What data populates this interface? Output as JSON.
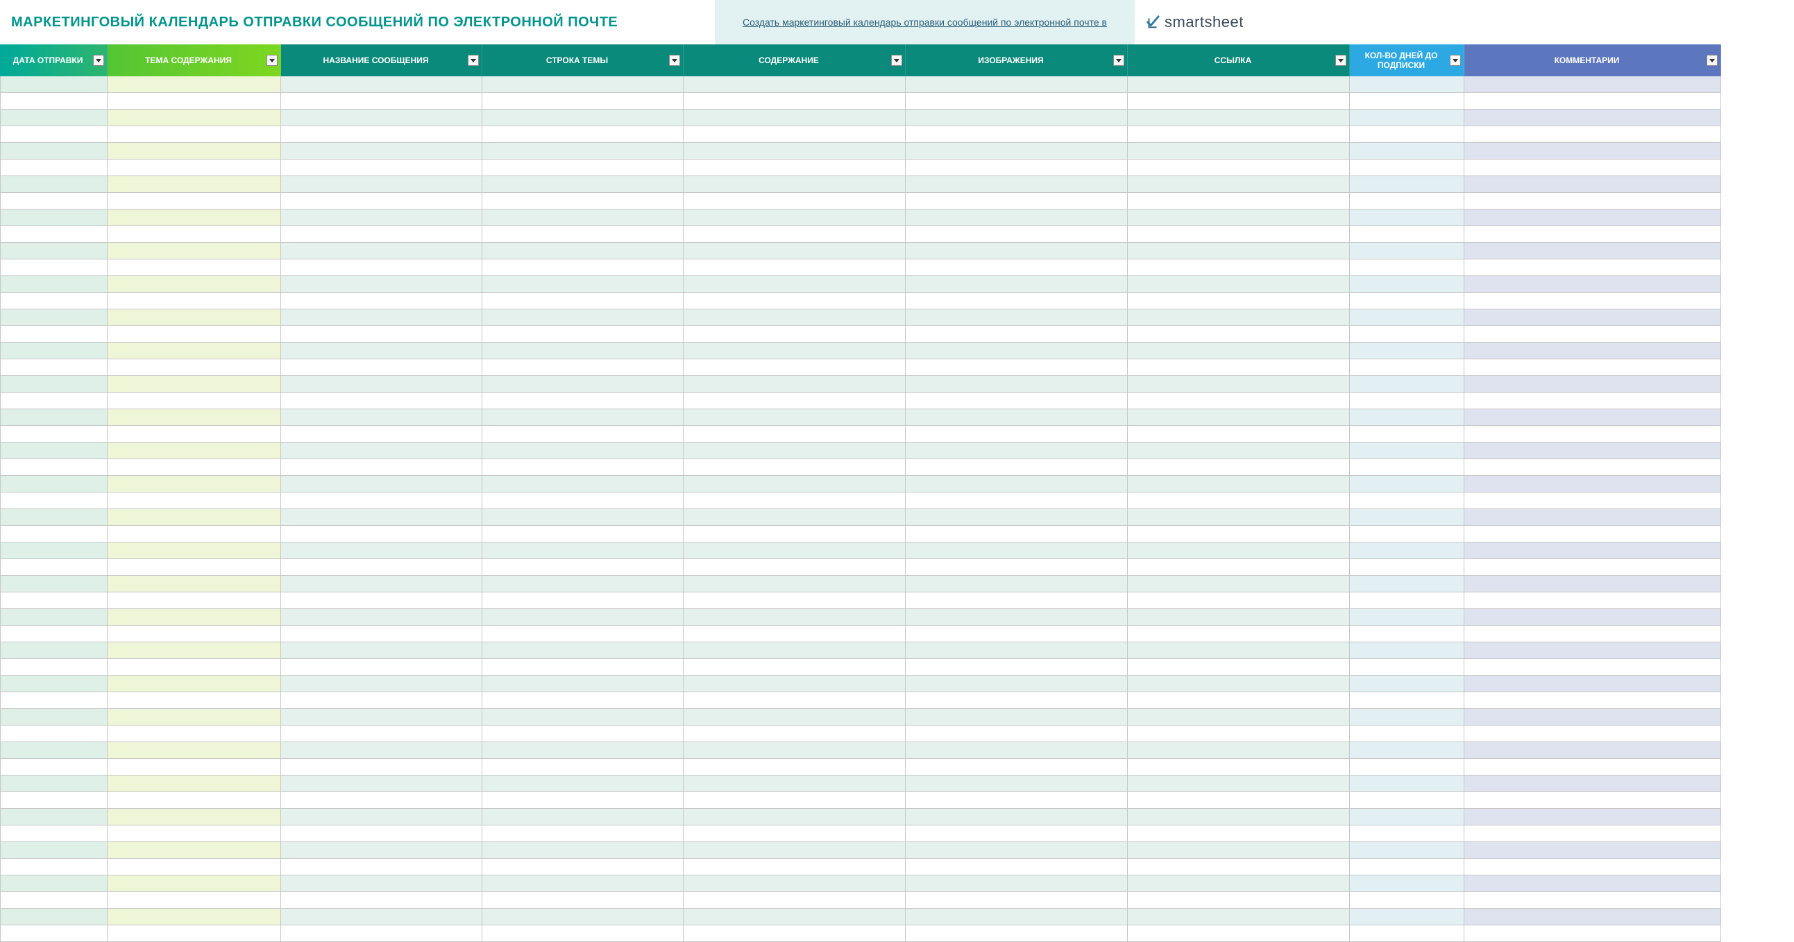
{
  "header": {
    "title": "МАРКЕТИНГОВЫЙ КАЛЕНДАРЬ ОТПРАВКИ СООБЩЕНИЙ ПО ЭЛЕКТРОННОЙ ПОЧТЕ",
    "link_text": "Создать маркетинговый календарь отправки сообщений по электронной почте в",
    "brand": "smartsheet"
  },
  "columns": [
    {
      "label": "ДАТА ОТПРАВКИ"
    },
    {
      "label": "ТЕМА СОДЕРЖАНИЯ"
    },
    {
      "label": "НАЗВАНИЕ СООБЩЕНИЯ"
    },
    {
      "label": "СТРОКА ТЕМЫ"
    },
    {
      "label": "СОДЕРЖАНИЕ"
    },
    {
      "label": "ИЗОБРАЖЕНИЯ"
    },
    {
      "label": "ССЫЛКА"
    },
    {
      "label": "КОЛ-ВО ДНЕЙ ДО ПОДПИСКИ"
    },
    {
      "label": "КОММЕНТАРИИ"
    }
  ],
  "row_count": 52,
  "rows": []
}
